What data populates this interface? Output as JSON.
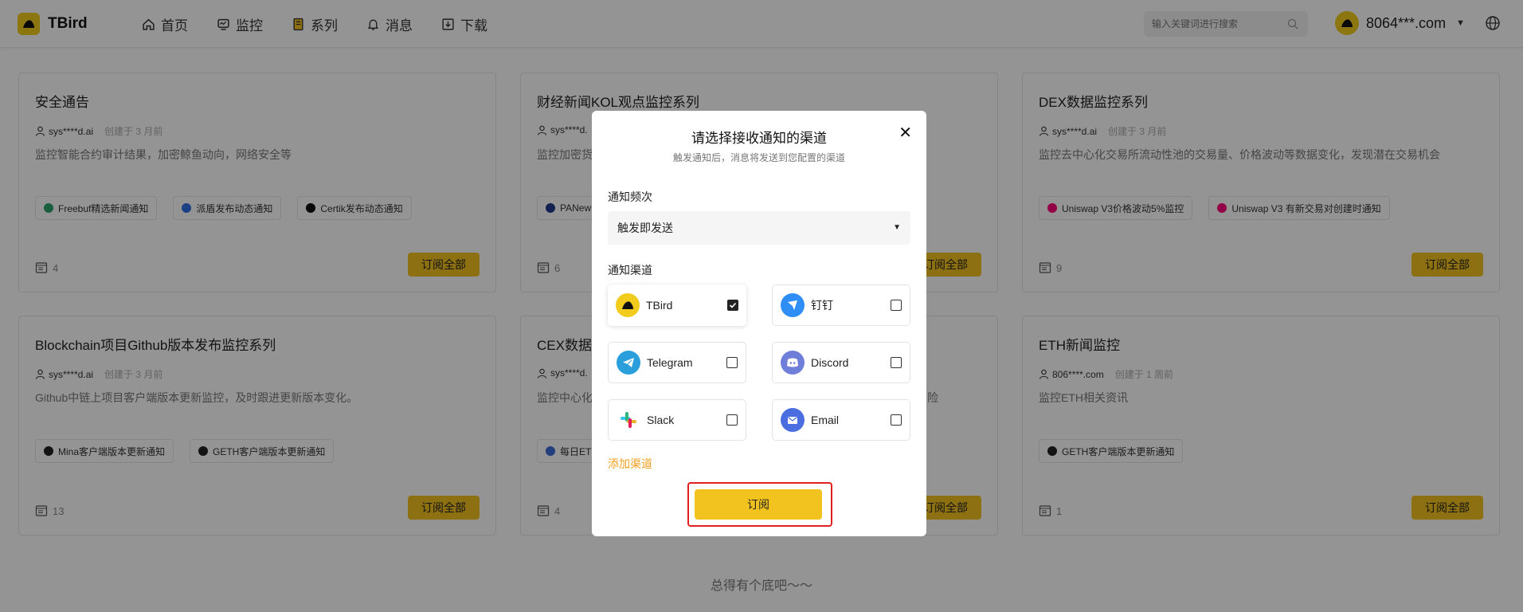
{
  "header": {
    "brand": "TBird",
    "nav": [
      {
        "label": "首页",
        "icon": "home-icon"
      },
      {
        "label": "监控",
        "icon": "monitor-icon"
      },
      {
        "label": "系列",
        "icon": "book-icon"
      },
      {
        "label": "消息",
        "icon": "bell-icon"
      },
      {
        "label": "下载",
        "icon": "download-icon"
      }
    ],
    "search_placeholder": "输入关键词进行搜索",
    "user_name": "8064***.com"
  },
  "cards": [
    {
      "title": "安全通告",
      "author": "sys****d.ai",
      "created": "创建于 3 月前",
      "description": "监控智能合约审计结果，加密鲸鱼动向，网络安全等",
      "tags": [
        "Freebuf精选新闻通知",
        "派盾发布动态通知",
        "Certik发布动态通知"
      ],
      "count": "4",
      "button": "订阅全部"
    },
    {
      "title": "财经新闻KOL观点监控系列",
      "author": "sys****d.",
      "created": "",
      "description": "监控加密货",
      "tags": [
        "PANew"
      ],
      "count": "6",
      "button": "订阅全部"
    },
    {
      "title": "DEX数据监控系列",
      "author": "sys****d.ai",
      "created": "创建于 3 月前",
      "description": "监控去中心化交易所流动性池的交易量、价格波动等数据变化，发现潜在交易机会",
      "tags": [
        "Uniswap V3价格波动5%监控",
        "Uniswap V3 有新交易对创建时通知"
      ],
      "count": "9",
      "button": "订阅全部"
    },
    {
      "title": "Blockchain项目Github版本发布监控系列",
      "author": "sys****d.ai",
      "created": "创建于 3 月前",
      "description": "Github中链上项目客户端版本更新监控，及时跟进更新版本变化。",
      "tags": [
        "Mina客户端版本更新通知",
        "GETH客户端版本更新通知"
      ],
      "count": "13",
      "button": "订阅全部"
    },
    {
      "title": "CEX数据监",
      "author": "sys****d.",
      "created": "",
      "description": "监控中心化",
      "description_tail": "险",
      "tags": [
        "每日ET"
      ],
      "count": "4",
      "button": "订阅全部"
    },
    {
      "title": "ETH新闻监控",
      "author": "806****.com",
      "created": "创建于 1 周前",
      "description": "监控ETH相关资讯",
      "tags": [
        "GETH客户端版本更新通知"
      ],
      "count": "1",
      "button": "订阅全部"
    }
  ],
  "footer_note": "总得有个底吧～～",
  "modal": {
    "title": "请选择接收通知的渠道",
    "subtitle": "触发通知后，消息将发送到您配置的渠道",
    "frequency_label": "通知频次",
    "frequency_value": "触发即发送",
    "channel_label": "通知渠道",
    "channels": [
      {
        "name": "TBird",
        "checked": true,
        "color": "#f2cb1d"
      },
      {
        "name": "钉钉",
        "checked": false,
        "color": "#2f8ef5"
      },
      {
        "name": "Telegram",
        "checked": false,
        "color": "#2a9fdb"
      },
      {
        "name": "Discord",
        "checked": false,
        "color": "#6f7ed9"
      },
      {
        "name": "Slack",
        "checked": false,
        "color": "#e01e5a"
      },
      {
        "name": "Email",
        "checked": false,
        "color": "#4a6ee0"
      }
    ],
    "add_channel": "添加渠道",
    "confirm": "订阅",
    "close": "✕"
  },
  "colors": {
    "accent": "#f2c21f",
    "link_orange": "#f0a020",
    "highlight_red": "#e02020"
  }
}
